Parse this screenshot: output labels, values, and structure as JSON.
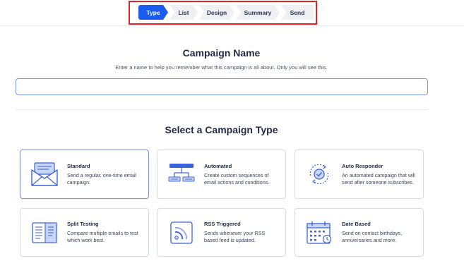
{
  "stepper": {
    "steps": [
      {
        "label": "Type",
        "active": true
      },
      {
        "label": "List",
        "active": false
      },
      {
        "label": "Design",
        "active": false
      },
      {
        "label": "Summary",
        "active": false
      },
      {
        "label": "Send",
        "active": false
      }
    ]
  },
  "campaign_name": {
    "heading": "Campaign Name",
    "helper": "Enter a name to help you remember what this campaign is all about. Only you will see this.",
    "value": "",
    "placeholder": ""
  },
  "campaign_type": {
    "heading": "Select a Campaign Type",
    "cards": [
      {
        "title": "Standard",
        "description": "Send a regular, one-time email campaign.",
        "icon": "envelope-icon",
        "selected": true
      },
      {
        "title": "Automated",
        "description": "Create custom sequences of email actions and conditions.",
        "icon": "workflow-icon",
        "selected": false
      },
      {
        "title": "Auto Responder",
        "description": "An automated campaign that will send after someone subscribes.",
        "icon": "auto-responder-icon",
        "selected": false
      },
      {
        "title": "Split Testing",
        "description": "Compare multiple emails to test which work best.",
        "icon": "split-test-icon",
        "selected": false
      },
      {
        "title": "RSS Triggered",
        "description": "Sends whenever your RSS based feed is updated.",
        "icon": "rss-icon",
        "selected": false
      },
      {
        "title": "Date Based",
        "description": "Send on contact birthdays, anniversaries and more.",
        "icon": "calendar-icon",
        "selected": false
      }
    ]
  },
  "colors": {
    "accent": "#1a5cf0",
    "highlight_box": "#d9262c",
    "icon_blue": "#3d63d8",
    "icon_light": "#c9d6f7"
  }
}
